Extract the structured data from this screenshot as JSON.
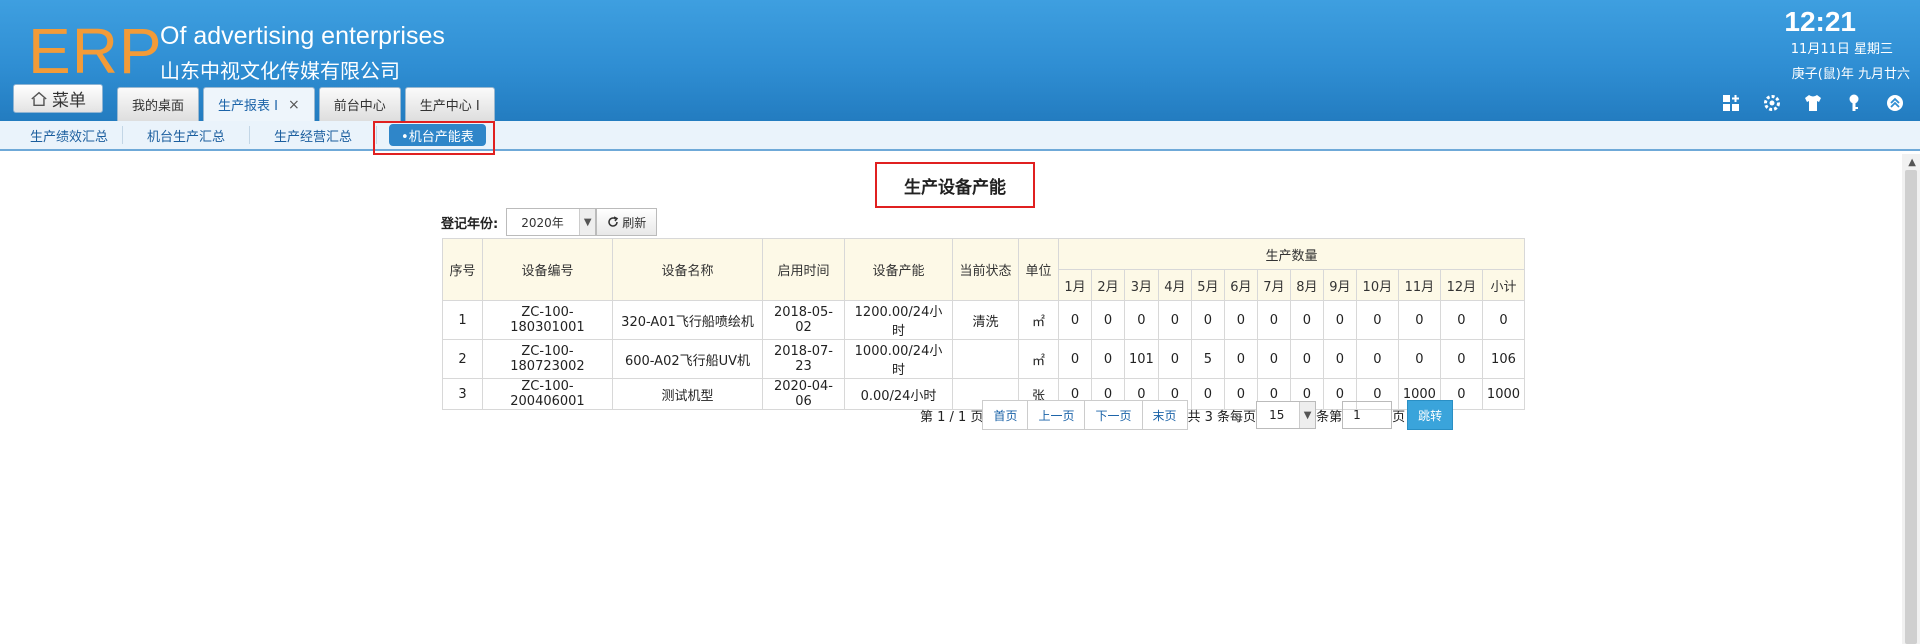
{
  "header": {
    "logo": "ERP",
    "brand_en": "Of advertising enterprises",
    "brand_cn": "山东中视文化传媒有限公司",
    "clock": "12:21",
    "date": "11月11日 星期三",
    "lunar": "庚子(鼠)年 九月廿六",
    "menu_label": "菜单",
    "tabs": [
      {
        "label": "我的桌面"
      },
      {
        "label": "生产报表 I",
        "close": "×"
      },
      {
        "label": "前台中心"
      },
      {
        "label": "生产中心 I"
      }
    ]
  },
  "subnav": {
    "items": [
      "生产绩效汇总",
      "机台生产汇总",
      "生产经营汇总",
      "•机台产能表"
    ]
  },
  "report": {
    "title": "生产设备产能",
    "filter_label": "登记年份:",
    "year_value": "2020年",
    "refresh_label": "刷新",
    "columns": {
      "seq": "序号",
      "code": "设备编号",
      "name": "设备名称",
      "start": "启用时间",
      "capacity": "设备产能",
      "status": "当前状态",
      "unit": "单位",
      "qty": "生产数量",
      "months": [
        "1月",
        "2月",
        "3月",
        "4月",
        "5月",
        "6月",
        "7月",
        "8月",
        "9月",
        "10月",
        "11月",
        "12月",
        "小计"
      ]
    },
    "rows": [
      {
        "seq": "1",
        "code": "ZC-100-180301001",
        "name": "320-A01飞行船喷绘机",
        "start": "2018-05-02",
        "capacity": "1200.00/24小时",
        "status": "清洗",
        "unit": "㎡",
        "months": [
          "0",
          "0",
          "0",
          "0",
          "0",
          "0",
          "0",
          "0",
          "0",
          "0",
          "0",
          "0",
          "0"
        ]
      },
      {
        "seq": "2",
        "code": "ZC-100-180723002",
        "name": "600-A02飞行船UV机",
        "start": "2018-07-23",
        "capacity": "1000.00/24小时",
        "status": "",
        "unit": "㎡",
        "months": [
          "0",
          "0",
          "101",
          "0",
          "5",
          "0",
          "0",
          "0",
          "0",
          "0",
          "0",
          "0",
          "106"
        ]
      },
      {
        "seq": "3",
        "code": "ZC-100-200406001",
        "name": "测试机型",
        "start": "2020-04-06",
        "capacity": "0.00/24小时",
        "status": "",
        "unit": "张",
        "months": [
          "0",
          "0",
          "0",
          "0",
          "0",
          "0",
          "0",
          "0",
          "0",
          "0",
          "1000",
          "0",
          "1000"
        ]
      }
    ]
  },
  "pager": {
    "page_info": "第 1 / 1 页",
    "first": "首页",
    "prev": "上一页",
    "next": "下一页",
    "last": "末页",
    "total_prefix": "共 3 条每页",
    "page_size": "15",
    "goto_prefix": "条第",
    "goto_value": "1",
    "goto_suffix": "页",
    "go": "跳转"
  }
}
